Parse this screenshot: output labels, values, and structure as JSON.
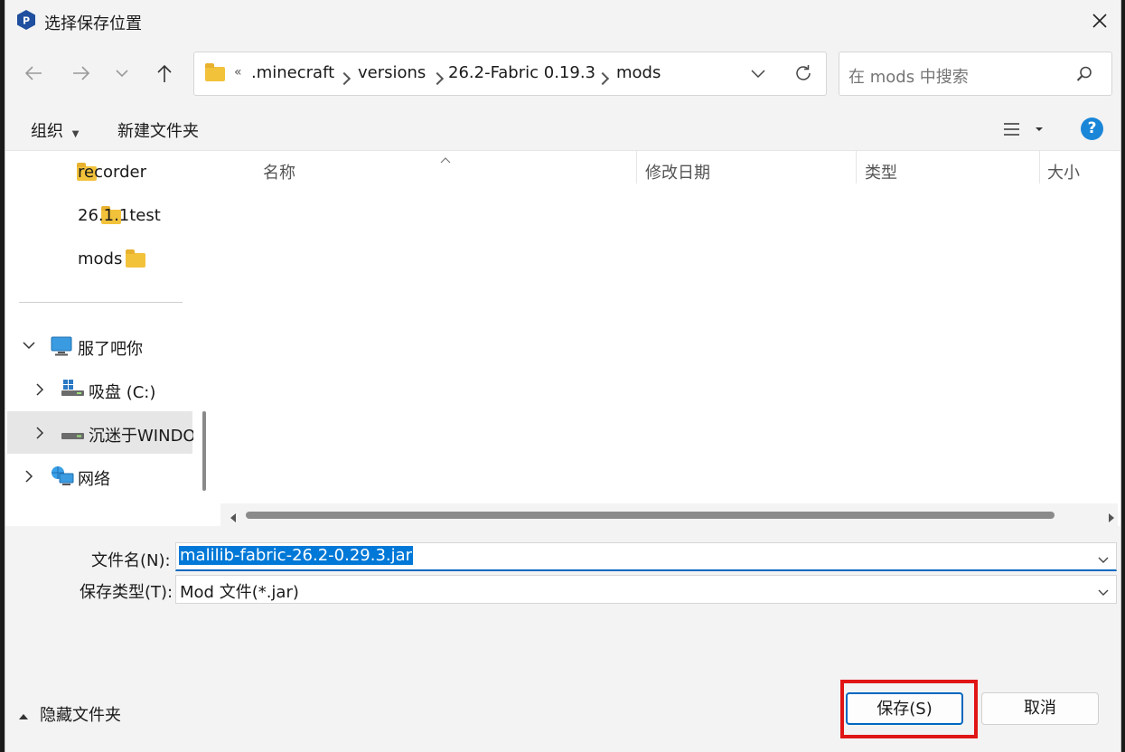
{
  "dialog": {
    "title": "选择保存位置"
  },
  "nav": {
    "breadcrumb_prefix": "«",
    "path": [
      ".minecraft",
      "versions",
      "26.2-Fabric 0.19.3",
      "mods"
    ],
    "search_placeholder": "在 mods 中搜索"
  },
  "commands": {
    "organize": "组织",
    "new_folder": "新建文件夹"
  },
  "sidebar": {
    "folders": [
      "recorder",
      "26.1.1test",
      "mods"
    ],
    "pc": "服了吧你",
    "drive_c": "吸盘 (C:)",
    "drive_other": "沉迷于WINDO",
    "network": "网络"
  },
  "columns": {
    "name": "名称",
    "date": "修改日期",
    "type": "类型",
    "size": "大小"
  },
  "form": {
    "filename_label": "文件名(N):",
    "filename_value": "malilib-fabric-26.2-0.29.3.jar",
    "filetype_label": "保存类型(T):",
    "filetype_value": "Mod 文件(*.jar)"
  },
  "footer": {
    "hide_folders": "隐藏文件夹",
    "save": "保存(S)",
    "cancel": "取消"
  },
  "colors": {
    "accent": "#0067c0",
    "annotation": "#e01515",
    "help": "#1a86d8"
  }
}
